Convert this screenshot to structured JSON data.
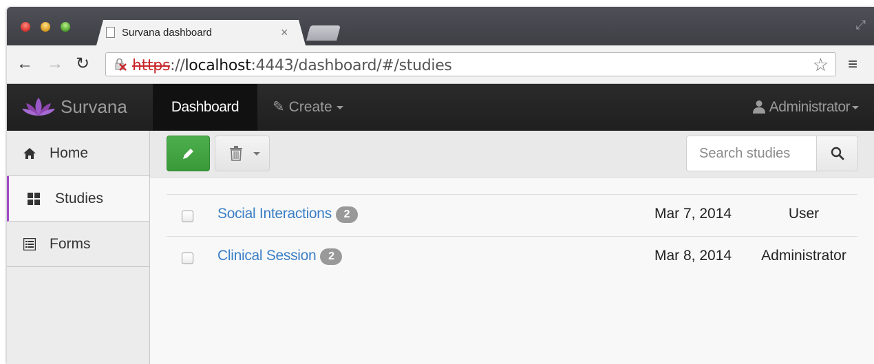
{
  "browser": {
    "tab_title": "Survana dashboard",
    "tab_close": "×",
    "url_protocol": "https",
    "url_separator": "://",
    "url_host": "localhost",
    "url_rest": ":4443/dashboard/#/studies"
  },
  "navbar": {
    "brand": "Survana",
    "dashboard": "Dashboard",
    "create": "Create",
    "user": "Administrator"
  },
  "sidebar": {
    "items": [
      {
        "label": "Home",
        "icon": "home-icon"
      },
      {
        "label": "Studies",
        "icon": "grid-icon",
        "active": true
      },
      {
        "label": "Forms",
        "icon": "list-icon"
      }
    ]
  },
  "toolbar": {
    "search_placeholder": "Search studies"
  },
  "studies": [
    {
      "title": "Social Interactions",
      "count": "2",
      "date": "Mar 7, 2014",
      "owner": "User"
    },
    {
      "title": "Clinical Session",
      "count": "2",
      "date": "Mar 8, 2014",
      "owner": "Administrator"
    }
  ],
  "colors": {
    "accent": "#a14bc8",
    "link": "#3a7ec6",
    "success": "#4cae4c",
    "navbar": "#222222"
  }
}
